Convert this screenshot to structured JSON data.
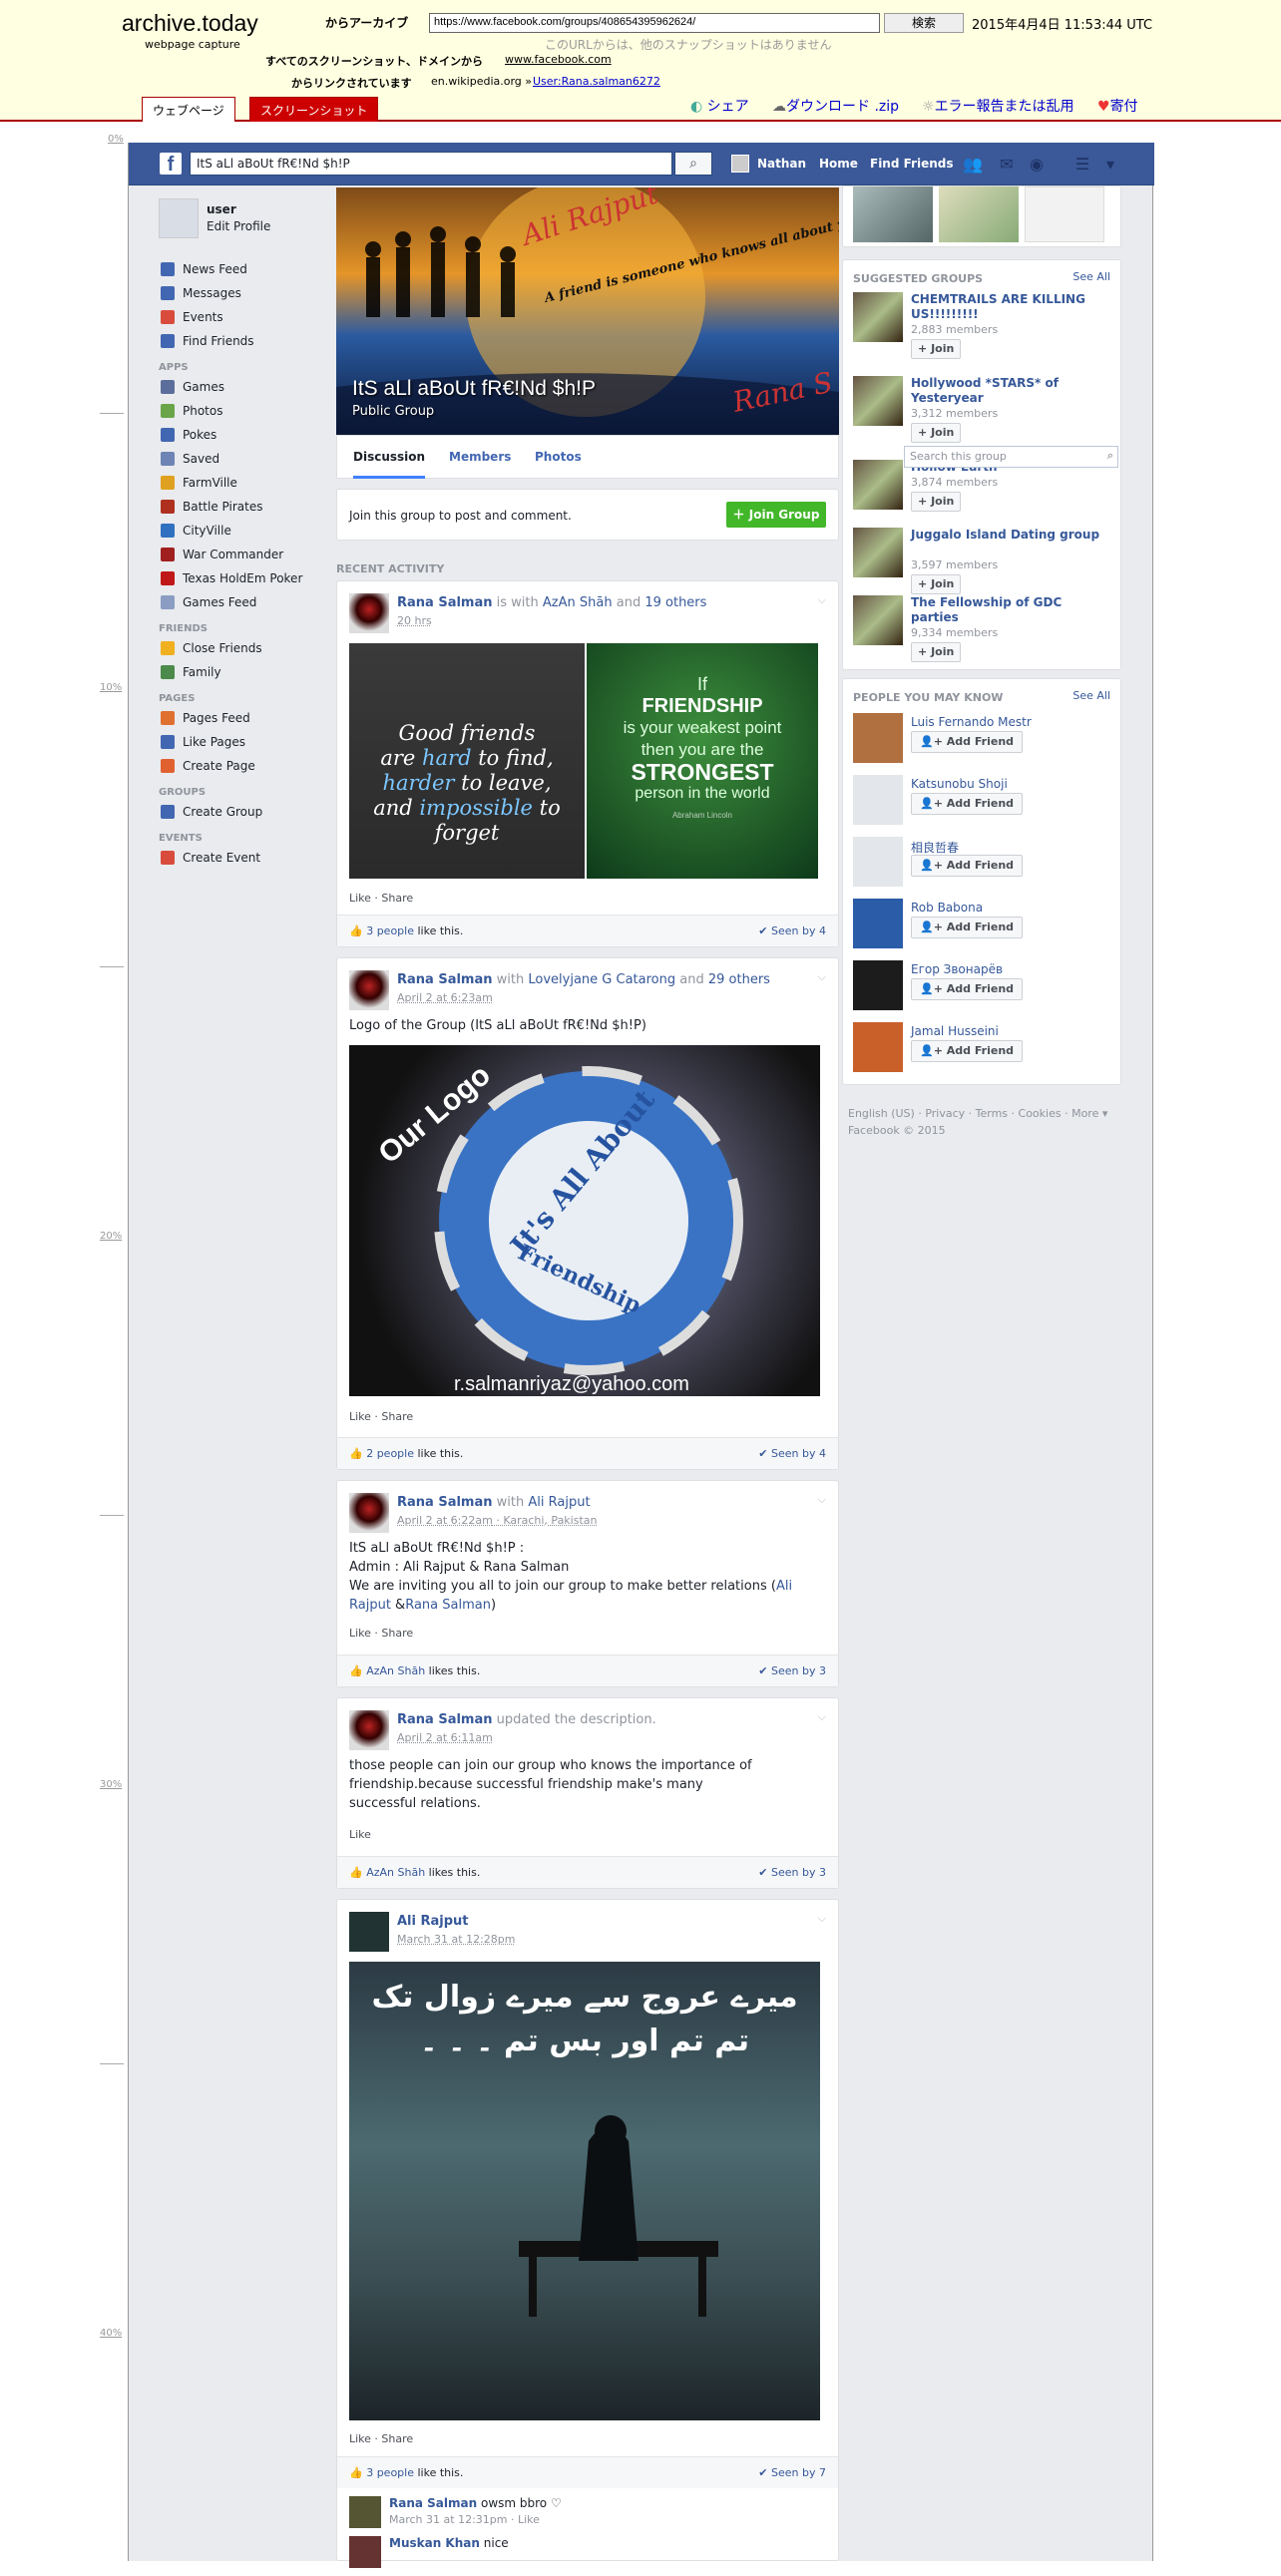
{
  "archive": {
    "logo": "archive.today",
    "sub": "webpage capture",
    "from_label": "からアーカイブ",
    "url": "https://www.facebook.com/groups/408654395962624/",
    "search_btn": "検索",
    "date": "2015年4月4日 11:53:44 UTC",
    "note": "このURLからは、他のスナップショットはありません",
    "all_shots_label": "すべてのスクリーンショット、ドメインから",
    "all_shots_domain": "www.facebook.com",
    "linked_label": "からリンクされています",
    "linked_src": "en.wikipedia.org »",
    "linked_user": "User:Rana.salman6272",
    "tab_web": "ウェブページ",
    "tab_shot": "スクリーンショット",
    "act_share": "シェア",
    "act_download": "ダウンロード .zip",
    "act_report": "エラー報告または乱用",
    "act_donate": "寄付"
  },
  "ruler": [
    "0%",
    "10%",
    "20%",
    "30%",
    "40%"
  ],
  "topbar": {
    "search": "ItS aLl aBoUt fR€!Nd $h!P",
    "user": "Nathan",
    "home": "Home",
    "find": "Find Friends"
  },
  "lnav": {
    "name": "user",
    "edit": "Edit Profile",
    "main": [
      {
        "label": "News Feed",
        "icon": "#4267b2"
      },
      {
        "label": "Messages",
        "icon": "#4267b2"
      },
      {
        "label": "Events",
        "icon": "#d94c3d"
      },
      {
        "label": "Find Friends",
        "icon": "#4267b2"
      }
    ],
    "apps_label": "APPS",
    "apps": [
      {
        "label": "Games",
        "icon": "#5b6d9a"
      },
      {
        "label": "Photos",
        "icon": "#6ba54a"
      },
      {
        "label": "Pokes",
        "icon": "#4267b2"
      },
      {
        "label": "Saved",
        "icon": "#6d84b4"
      },
      {
        "label": "FarmVille",
        "icon": "#e0a020"
      },
      {
        "label": "Battle Pirates",
        "icon": "#b03020"
      },
      {
        "label": "CityVille",
        "icon": "#3070c0"
      },
      {
        "label": "War Commander",
        "icon": "#a02020"
      },
      {
        "label": "Texas HoldEm Poker",
        "icon": "#c01818"
      },
      {
        "label": "Games Feed",
        "icon": "#8b9dc3"
      }
    ],
    "friends_label": "FRIENDS",
    "friends": [
      {
        "label": "Close Friends",
        "icon": "#f0b020"
      },
      {
        "label": "Family",
        "icon": "#4b8a4b"
      }
    ],
    "pages_label": "PAGES",
    "pages": [
      {
        "label": "Pages Feed",
        "icon": "#e07030"
      },
      {
        "label": "Like Pages",
        "icon": "#4267b2"
      },
      {
        "label": "Create Page",
        "icon": "#e06030"
      }
    ],
    "groups_label": "GROUPS",
    "groups": [
      {
        "label": "Create Group",
        "icon": "#4267b2"
      }
    ],
    "events_label": "EVENTS",
    "events": [
      {
        "label": "Create Event",
        "icon": "#d94c3d"
      }
    ]
  },
  "group": {
    "title": "ItS aLl aBoUt fR€!Nd $h!P",
    "type": "Public Group",
    "tabs": [
      "Discussion",
      "Members",
      "Photos"
    ],
    "join_text": "Join this group to post and comment.",
    "join_btn": "Join Group",
    "recent": "RECENT ACTIVITY",
    "cover_text": [
      "Ali Rajput",
      "A friend is someone who knows all about you and still loves you!",
      "Rana S"
    ]
  },
  "posts": [
    {
      "author": "Rana Salman",
      "with_text": "is with",
      "tag1": "AzAn Shāh",
      "and": "and",
      "tag2": "19 others",
      "time": "20 hrs",
      "img1_text": [
        "Good friends",
        "are",
        "hard",
        "to find,",
        "harder",
        "to leave,",
        "and",
        "impossible",
        "to forget"
      ],
      "img2_text": [
        "If",
        "FRIENDSHIP",
        "is your weakest point",
        "then you are the",
        "STRONGEST",
        "person in the world",
        "Abraham Lincoln"
      ],
      "actions": "Like · Share",
      "likes_link": "3 people",
      "likes_rest": "like this.",
      "seen": "Seen by 4"
    },
    {
      "author": "Rana Salman",
      "with_text": "with",
      "tag1": "Lovelyjane G Catarong",
      "and": "and",
      "tag2": "29 others",
      "time": "April 2 at 6:23am",
      "text": "Logo of the Group (ItS aLl aBoUt fR€!Nd $h!P)",
      "logo_top": "Our Logo",
      "logo_mid": "It's All About",
      "logo_bot": "Friendship",
      "logo_mail": "r.salmanriyaz@yahoo.com",
      "actions": "Like · Share",
      "likes_link": "2 people",
      "likes_rest": "like this.",
      "seen": "Seen by 4"
    },
    {
      "author": "Rana Salman",
      "with_text": "with",
      "tag1": "Ali Rajput",
      "time": "April 2 at 6:22am",
      "place": "· Karachi, Pakistan",
      "line1": "ItS aLl aBoUt fR€!Nd $h!P :",
      "line2": "Admin : Ali Rajput & Rana Salman",
      "line3a": "We are inviting you all to join our group to make better relations (",
      "line3b": "Ali Rajput",
      "line3c": " &",
      "line3d": "Rana Salman",
      "line3e": ")",
      "actions": "Like · Share",
      "likes_link": "AzAn Shāh",
      "likes_rest": "likes this.",
      "seen": "Seen by 3"
    },
    {
      "author": "Rana Salman",
      "with_text": "updated the description.",
      "time": "April 2 at 6:11am",
      "text": "those people can join our group who knows the importance of friendship.because successful friendship make's many successful relations.",
      "actions": "Like",
      "likes_link": "AzAn Shāh",
      "likes_rest": "likes this.",
      "seen": "Seen by 3"
    },
    {
      "author": "Ali Rajput",
      "time": "March 31 at 12:28pm",
      "urdu1": "میرے عروج سے میرے زوال تک",
      "urdu2": "تم تم اور بس تم ۔ ۔ ۔",
      "actions": "Like · Share",
      "likes_link": "3 people",
      "likes_rest": "like this.",
      "seen": "Seen by 7",
      "comments": [
        {
          "name": "Rana Salman",
          "text": "owsm bbro ♡",
          "time": "March 31 at 12:31pm · Like"
        },
        {
          "name": "Muskan Khan",
          "text": "nice",
          "time": ""
        }
      ]
    }
  ],
  "rcol": {
    "sg_label": "SUGGESTED GROUPS",
    "see_all": "See All",
    "search_placeholder": "Search this group",
    "groups": [
      {
        "name": "CHEMTRAILS ARE KILLING US!!!!!!!!!",
        "members": "2,883 members",
        "join": "Join"
      },
      {
        "name": "Hollywood *STARS* of Yesteryear",
        "members": "3,312 members",
        "join": "Join"
      },
      {
        "name": "Hollow Earth",
        "members": "3,874 members",
        "join": "Join"
      },
      {
        "name": "Juggalo Island Dating group",
        "members": "3,597 members",
        "join": "Join"
      },
      {
        "name": "The Fellowship of GDC parties",
        "members": "9,334 members",
        "join": "Join"
      }
    ],
    "pymk_label": "PEOPLE YOU MAY KNOW",
    "people": [
      {
        "name": "Luis Fernando Mestr",
        "add": "Add Friend"
      },
      {
        "name": "Katsunobu Shoji",
        "add": "Add Friend"
      },
      {
        "name": "相良哲春",
        "add": "Add Friend"
      },
      {
        "name": "Rob Babona",
        "add": "Add Friend"
      },
      {
        "name": "Егор Звонарёв",
        "add": "Add Friend"
      },
      {
        "name": "Jamal Husseini",
        "add": "Add Friend"
      }
    ],
    "footer1": "English (US) · Privacy · Terms · Cookies · More ▾",
    "footer2": "Facebook © 2015"
  }
}
